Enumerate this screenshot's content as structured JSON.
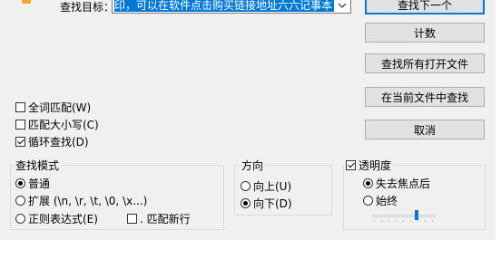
{
  "find": {
    "label": "查找目标：",
    "value": "印，可以在软件点击购买链接地址六六记事本",
    "dropdown_icon": "chevron-down-icon"
  },
  "buttons": {
    "find_next": "查找下一个",
    "count": "计数",
    "find_all_open": "查找所有打开文件",
    "find_in_current": "在当前文件中查找",
    "cancel": "取消"
  },
  "options": {
    "whole_word": {
      "label": "全词匹配(W)",
      "checked": false
    },
    "match_case": {
      "label": "匹配大小写(C)",
      "checked": false
    },
    "wrap_around": {
      "label": "循环查找(D)",
      "checked": true
    }
  },
  "search_mode": {
    "title": "查找模式",
    "normal": {
      "label": "普通",
      "selected": true
    },
    "extended": {
      "label": "扩展 (\\n, \\r, \\t, \\0, \\x...)",
      "selected": false
    },
    "regex": {
      "label": "正则表达式(E)",
      "selected": false
    },
    "dot_newline": {
      "label": ". 匹配新行",
      "checked": false
    }
  },
  "direction": {
    "title": "方向",
    "up": {
      "label": "向上(U)",
      "selected": false
    },
    "down": {
      "label": "向下(D)",
      "selected": true
    }
  },
  "transparency": {
    "title": "透明度",
    "enabled": true,
    "on_lose_focus": {
      "label": "失去焦点后",
      "selected": true
    },
    "always": {
      "label": "始终",
      "selected": false
    },
    "slider_level": 0.72
  },
  "colors": {
    "dialog_bg": "#f0f0f0",
    "selection": "#0078d7",
    "button_bg": "#e1e1e1"
  }
}
